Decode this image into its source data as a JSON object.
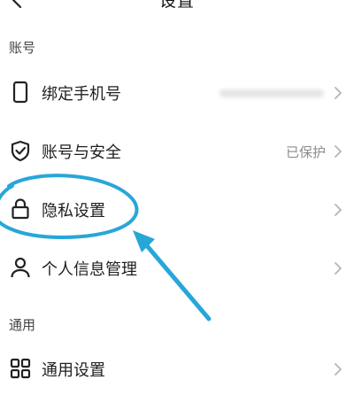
{
  "header": {
    "title": "设置",
    "back_icon": "back-arrow-icon"
  },
  "sections": {
    "account": {
      "title": "账号"
    },
    "general": {
      "title": "通用"
    }
  },
  "rows": {
    "bind_phone": {
      "label": "绑定手机号",
      "icon": "phone-icon"
    },
    "account_security": {
      "label": "账号与安全",
      "value": "已保护",
      "icon": "shield-check-icon"
    },
    "privacy": {
      "label": "隐私设置",
      "icon": "lock-icon"
    },
    "personal_info": {
      "label": "个人信息管理",
      "icon": "person-icon"
    },
    "general_settings": {
      "label": "通用设置",
      "icon": "grid-icon"
    }
  },
  "annotation": {
    "color": "#27a7d8"
  }
}
